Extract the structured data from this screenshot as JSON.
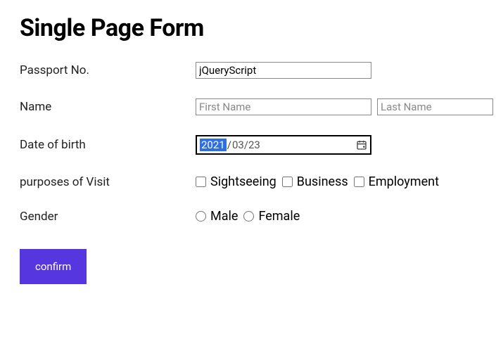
{
  "title": "Single Page Form",
  "form": {
    "passport": {
      "label": "Passport No.",
      "value": "jQueryScript"
    },
    "name": {
      "label": "Name",
      "first_placeholder": "First Name",
      "last_placeholder": "Last Name",
      "first_value": "",
      "last_value": ""
    },
    "dob": {
      "label": "Date of birth",
      "year": "2021",
      "slash": "/",
      "rest": "03/23"
    },
    "purposes": {
      "label": "purposes of Visit",
      "options": {
        "sightseeing": "Sightseeing",
        "business": "Business",
        "employment": "Employment"
      }
    },
    "gender": {
      "label": "Gender",
      "options": {
        "male": "Male",
        "female": "Female"
      }
    },
    "confirm_label": "confirm"
  }
}
